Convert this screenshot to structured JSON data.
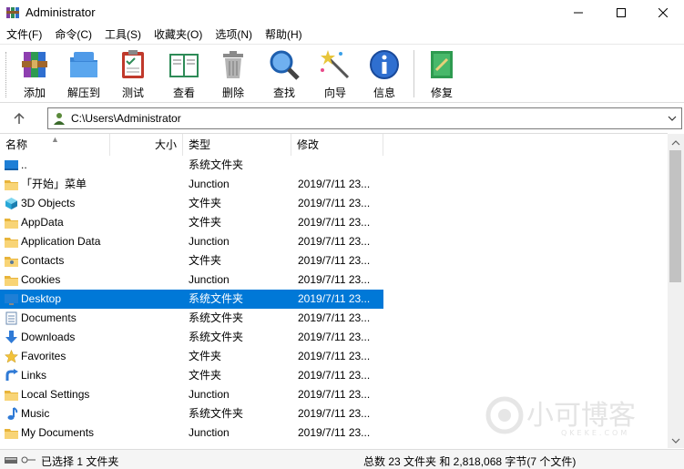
{
  "window": {
    "title": "Administrator"
  },
  "menu": [
    "文件(F)",
    "命令(C)",
    "工具(S)",
    "收藏夹(O)",
    "选项(N)",
    "帮助(H)"
  ],
  "toolbar": {
    "add": "添加",
    "extract": "解压到",
    "test": "测试",
    "view": "查看",
    "delete": "删除",
    "find": "查找",
    "wizard": "向导",
    "info": "信息",
    "repair": "修复"
  },
  "address": {
    "path": "C:\\Users\\Administrator"
  },
  "columns": {
    "name": "名称",
    "size": "大小",
    "type": "类型",
    "modified": "修改"
  },
  "files": [
    {
      "name": "..",
      "type": "系统文件夹",
      "modified": "",
      "icon": "drive-folder-icon"
    },
    {
      "name": "「开始」菜单",
      "type": "Junction",
      "modified": "2019/7/11 23...",
      "icon": "folder-icon"
    },
    {
      "name": "3D Objects",
      "type": "文件夹",
      "modified": "2019/7/11 23...",
      "icon": "3d-objects-icon"
    },
    {
      "name": "AppData",
      "type": "文件夹",
      "modified": "2019/7/11 23...",
      "icon": "folder-icon"
    },
    {
      "name": "Application Data",
      "type": "Junction",
      "modified": "2019/7/11 23...",
      "icon": "folder-icon"
    },
    {
      "name": "Contacts",
      "type": "文件夹",
      "modified": "2019/7/11 23...",
      "icon": "contacts-icon"
    },
    {
      "name": "Cookies",
      "type": "Junction",
      "modified": "2019/7/11 23...",
      "icon": "folder-icon"
    },
    {
      "name": "Desktop",
      "type": "系统文件夹",
      "modified": "2019/7/11 23...",
      "icon": "desktop-icon"
    },
    {
      "name": "Documents",
      "type": "系统文件夹",
      "modified": "2019/7/11 23...",
      "icon": "documents-icon"
    },
    {
      "name": "Downloads",
      "type": "系统文件夹",
      "modified": "2019/7/11 23...",
      "icon": "downloads-icon"
    },
    {
      "name": "Favorites",
      "type": "文件夹",
      "modified": "2019/7/11 23...",
      "icon": "favorites-icon"
    },
    {
      "name": "Links",
      "type": "文件夹",
      "modified": "2019/7/11 23...",
      "icon": "links-icon"
    },
    {
      "name": "Local Settings",
      "type": "Junction",
      "modified": "2019/7/11 23...",
      "icon": "folder-icon"
    },
    {
      "name": "Music",
      "type": "系统文件夹",
      "modified": "2019/7/11 23...",
      "icon": "music-icon"
    },
    {
      "name": "My Documents",
      "type": "Junction",
      "modified": "2019/7/11 23...",
      "icon": "folder-icon"
    }
  ],
  "selected_row": "Desktop",
  "watermark": {
    "brand": "小可博客",
    "domain": "QKEKE.COM"
  },
  "status": {
    "left": "已选择 1 文件夹",
    "right": "总数 23 文件夹 和 2,818,068 字节(7 个文件)"
  },
  "colors": {
    "selection": "#0078d7",
    "folder": "#f4c542"
  }
}
